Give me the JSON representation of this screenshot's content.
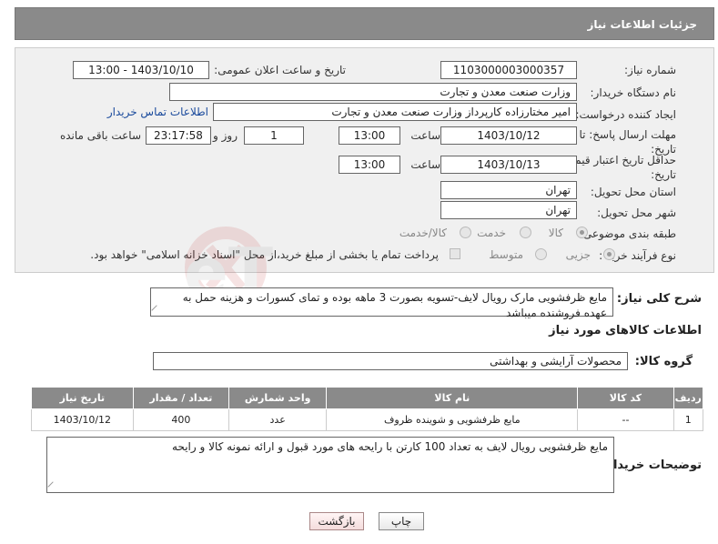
{
  "header": {
    "title": "جزئیات اطلاعات نیاز"
  },
  "fields": {
    "need_number": {
      "label": "شماره نیاز:",
      "value": "1103000003000357"
    },
    "announce_datetime": {
      "label": "تاریخ و ساعت اعلان عمومی:",
      "value": "1403/10/10 - 13:00"
    },
    "buyer_org": {
      "label": "نام دستگاه خریدار:",
      "value": "وزارت صنعت معدن و تجارت"
    },
    "requester": {
      "label": "ایجاد کننده درخواست:",
      "value": "امیر مختارزاده کارپرداز وزارت صنعت معدن و تجارت",
      "contact_link": "اطلاعات تماس خریدار"
    },
    "reply_deadline": {
      "label": "مهلت ارسال پاسخ: تا تاریخ:",
      "date": "1403/10/12",
      "time_label": "ساعت",
      "time": "13:00",
      "days": "1",
      "days_label": "روز و",
      "remaining": "23:17:58",
      "remaining_label": "ساعت باقی مانده"
    },
    "price_validity": {
      "label": "حداقل تاریخ اعتبار قیمت: تا تاریخ:",
      "date": "1403/10/13",
      "time_label": "ساعت",
      "time": "13:00"
    },
    "delivery_province": {
      "label": "استان محل تحویل:",
      "value": "تهران"
    },
    "delivery_city": {
      "label": "شهر محل تحویل:",
      "value": "تهران"
    },
    "category": {
      "label": "طبقه بندی موضوعی:",
      "options": [
        "کالا",
        "خدمت",
        "کالا/خدمت"
      ],
      "selected": "کالا"
    },
    "purchase_process": {
      "label": "نوع فرآیند خرید :",
      "options": [
        "جزیی",
        "متوسط"
      ],
      "selected": "جزیی",
      "treasury_note": "پرداخت تمام یا بخشی از مبلغ خرید،از محل \"اسناد خزانه اسلامی\" خواهد بود."
    }
  },
  "description": {
    "label": "شرح کلی نیاز:",
    "value": "مایع ظرفشویی مارک رویال لایف-تسویه بصورت 3 ماهه بوده و تمای کسورات و هزینه حمل به عهده فروشنده میباشد"
  },
  "goods_info": {
    "title": "اطلاعات کالاهای مورد نیاز",
    "group_label": "گروه کالا:",
    "group_value": "محصولات آرایشی و بهداشتی"
  },
  "table": {
    "headers": [
      "ردیف",
      "کد کالا",
      "نام کالا",
      "واحد شمارش",
      "تعداد / مقدار",
      "تاریخ نیاز"
    ],
    "rows": [
      [
        "1",
        "--",
        "مایع ظرفشویی و شوینده ظروف",
        "عدد",
        "400",
        "1403/10/12"
      ]
    ]
  },
  "buyer_notes": {
    "label": "توضیحات خریدار:",
    "value": "مایع ظرفشویی رویال لایف به تعداد 100 کارتن با رایحه های مورد قبول و ارائه نمونه کالا و رایحه"
  },
  "buttons": {
    "print": "چاپ",
    "back": "بازگشت"
  },
  "watermark": {
    "text": "AriaTender.neT"
  }
}
